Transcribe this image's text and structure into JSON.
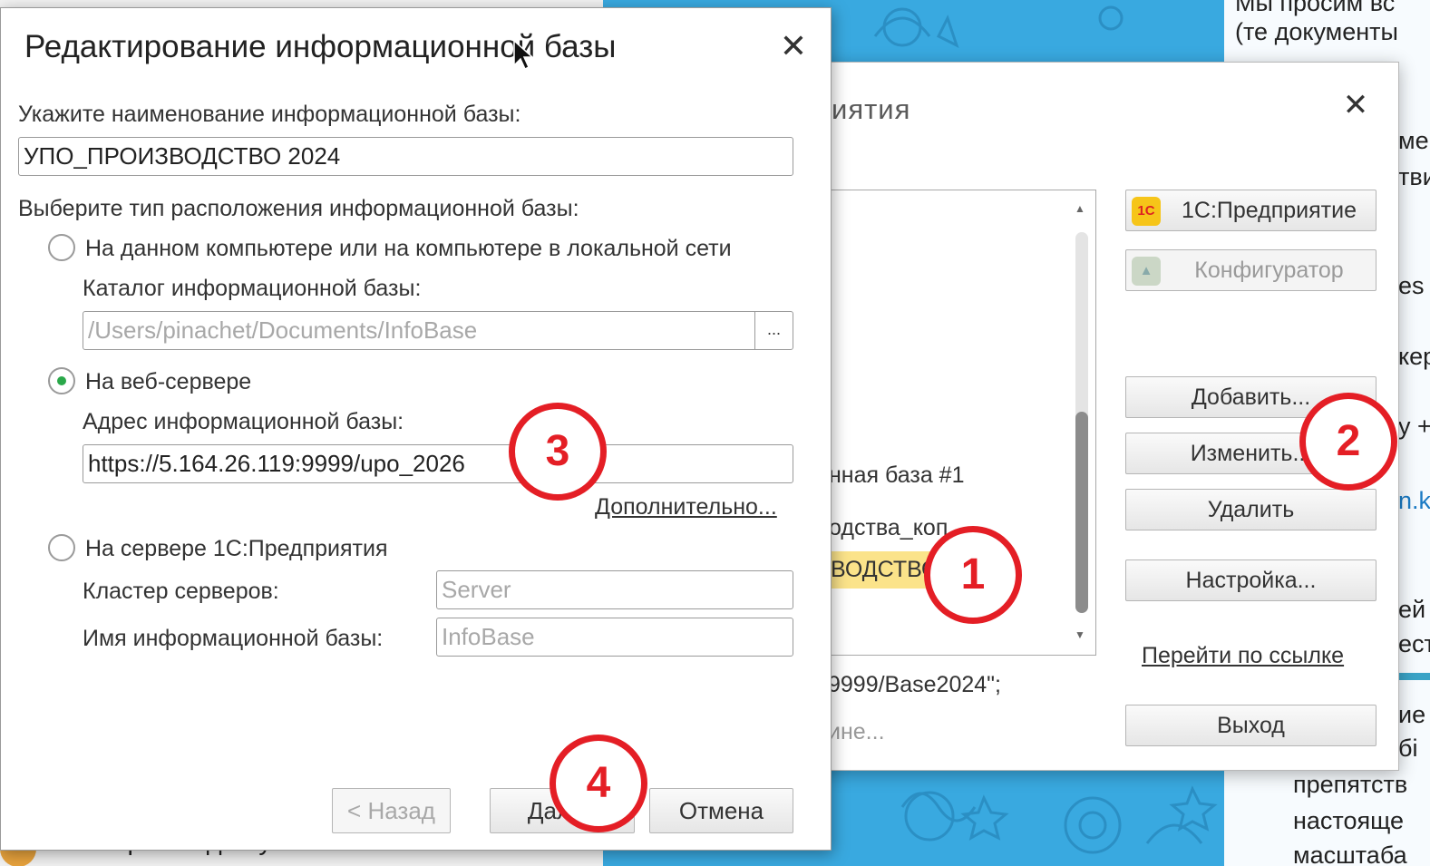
{
  "background": {
    "left_bottom_text": "Открытки для улыбки",
    "right_texts": [
      "Мы просим вс",
      "(те документы",
      "ме",
      "тви",
      "es",
      "кер",
      "у +",
      "n.k",
      "ей",
      "ест",
      "ие",
      "бі",
      "препятств",
      "настояще",
      "масштаба"
    ]
  },
  "launcher": {
    "title_fragment": "иятия",
    "list_items": [
      "нная база #1",
      "одства_коп",
      "ВОДСТВО"
    ],
    "selected_index": 2,
    "path_fragment": "9999/Base2024\";",
    "search_fragment": "ине...",
    "buttons": {
      "enterprise": "1С:Предприятие",
      "designer": "Конфигуратор",
      "add": "Добавить...",
      "edit": "Изменить...",
      "delete": "Удалить",
      "settings": "Настройка...",
      "follow_link": "Перейти по ссылке",
      "exit": "Выход"
    },
    "logo_text": "1С"
  },
  "dialog": {
    "title": "Редактирование информационной базы",
    "name_label": "Укажите наименование информационной базы:",
    "name_value": "УПО_ПРОИЗВОДСТВО 2024",
    "location_label": "Выберите тип расположения информационной базы:",
    "option_local": "На данном компьютере или на компьютере в локальной сети",
    "catalog_label": "Каталог информационной базы:",
    "catalog_placeholder": "/Users/pinachet/Documents/InfoBase",
    "browse_label": "...",
    "option_web": "На веб-сервере",
    "address_label": "Адрес информационной базы:",
    "address_value": "https://5.164.26.119:9999/upo_2026",
    "more_link": "Дополнительно...",
    "option_server": "На сервере 1С:Предприятия",
    "cluster_label": "Кластер серверов:",
    "cluster_placeholder": "Server",
    "infobase_label": "Имя информационной базы:",
    "infobase_placeholder": "InfoBase",
    "selected_option": "web",
    "buttons": {
      "back": "< Назад",
      "next": "Далее",
      "cancel": "Отмена"
    }
  },
  "annotations": [
    "1",
    "2",
    "3",
    "4"
  ],
  "colors": {
    "annotation_red": "#e41e25",
    "selection_yellow": "#fbe38a",
    "radio_green": "#2aa84a",
    "background_blue": "#39a9e0"
  }
}
